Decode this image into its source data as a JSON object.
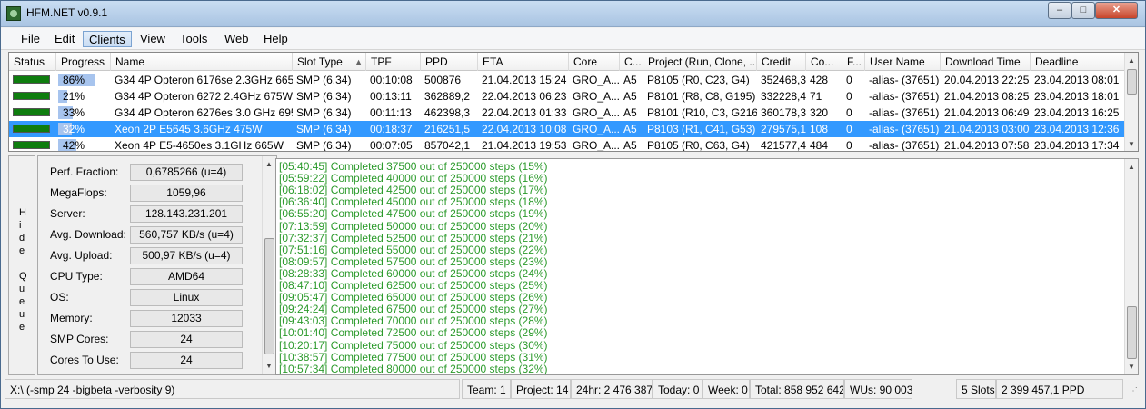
{
  "window": {
    "title": "HFM.NET v0.9.1",
    "min": "–",
    "max": "□",
    "close": "✕"
  },
  "menu": [
    "File",
    "Edit",
    "Clients",
    "View",
    "Tools",
    "Web",
    "Help"
  ],
  "grid": {
    "headers": [
      "Status",
      "Progress",
      "Name",
      "Slot Type",
      "TPF",
      "PPD",
      "ETA",
      "Core",
      "C...",
      "Project (Run, Clone, ...",
      "Credit",
      "Co...",
      "F...",
      "User Name",
      "Download Time",
      "Deadline"
    ],
    "sort_indicator": "▲",
    "rows": [
      {
        "progress": "86%",
        "pct": 86,
        "name": "G34 4P Opteron 6176se 2.3GHz 665 ...",
        "slot": "SMP (6.34)",
        "tpf": "00:10:08",
        "ppd": "500876",
        "eta": "21.04.2013 15:24",
        "core": "GRO_A...",
        "c": "A5",
        "project": "P8105 (R0, C23, G4)",
        "credit": "352468,3",
        "co": "428",
        "f": "0",
        "user": "-alias- (37651)",
        "download": "20.04.2013 22:25",
        "deadline": "23.04.2013 08:01"
      },
      {
        "progress": "21%",
        "pct": 21,
        "name": "G34 4P Opteron 6272 2.4GHz 675Watt",
        "slot": "SMP (6.34)",
        "tpf": "00:13:11",
        "ppd": "362889,2",
        "eta": "22.04.2013 06:23",
        "core": "GRO_A...",
        "c": "A5",
        "project": "P8101 (R8, C8, G195)",
        "credit": "332228,4",
        "co": "71",
        "f": "0",
        "user": "-alias- (37651)",
        "download": "21.04.2013 08:25",
        "deadline": "23.04.2013 18:01"
      },
      {
        "progress": "33%",
        "pct": 33,
        "name": "G34 4P Opteron 6276es 3.0 GHz 695...",
        "slot": "SMP (6.34)",
        "tpf": "00:11:13",
        "ppd": "462398,3",
        "eta": "22.04.2013 01:33",
        "core": "GRO_A...",
        "c": "A5",
        "project": "P8101 (R10, C3, G216)",
        "credit": "360178,3",
        "co": "320",
        "f": "0",
        "user": "-alias- (37651)",
        "download": "21.04.2013 06:49",
        "deadline": "23.04.2013 16:25"
      },
      {
        "progress": "32%",
        "pct": 32,
        "name": "Xeon 2P E5645 3.6GHz 475W",
        "slot": "SMP (6.34)",
        "tpf": "00:18:37",
        "ppd": "216251,5",
        "eta": "22.04.2013 10:08",
        "core": "GRO_A...",
        "c": "A5",
        "project": "P8103 (R1, C41, G53)",
        "credit": "279575,1",
        "co": "108",
        "f": "0",
        "user": "-alias- (37651)",
        "download": "21.04.2013 03:00",
        "deadline": "23.04.2013 12:36"
      },
      {
        "progress": "42%",
        "pct": 42,
        "name": "Xeon 4P E5-4650es 3.1GHz 665W",
        "slot": "SMP (6.34)",
        "tpf": "00:07:05",
        "ppd": "857042,1",
        "eta": "21.04.2013 19:53",
        "core": "GRO_A...",
        "c": "A5",
        "project": "P8105 (R0, C63, G4)",
        "credit": "421577,4",
        "co": "484",
        "f": "0",
        "user": "-alias- (37651)",
        "download": "21.04.2013 07:58",
        "deadline": "23.04.2013 17:34"
      }
    ]
  },
  "hide_queue": [
    "H",
    "i",
    "d",
    "e",
    "",
    "Q",
    "u",
    "e",
    "u",
    "e"
  ],
  "info": [
    {
      "label": "Perf. Fraction:",
      "value": "0,6785266 (u=4)"
    },
    {
      "label": "MegaFlops:",
      "value": "1059,96"
    },
    {
      "label": "Server:",
      "value": "128.143.231.201"
    },
    {
      "label": "Avg. Download:",
      "value": "560,757 KB/s (u=4)"
    },
    {
      "label": "Avg. Upload:",
      "value": "500,97 KB/s (u=4)"
    },
    {
      "label": "CPU Type:",
      "value": "AMD64"
    },
    {
      "label": "OS:",
      "value": "Linux"
    },
    {
      "label": "Memory:",
      "value": "12033"
    },
    {
      "label": "SMP Cores:",
      "value": "24"
    },
    {
      "label": "Cores To Use:",
      "value": "24"
    }
  ],
  "log": [
    "[05:40:45] Completed 37500 out of 250000 steps  (15%)",
    "[05:59:22] Completed 40000 out of 250000 steps  (16%)",
    "[06:18:02] Completed 42500 out of 250000 steps  (17%)",
    "[06:36:40] Completed 45000 out of 250000 steps  (18%)",
    "[06:55:20] Completed 47500 out of 250000 steps  (19%)",
    "[07:13:59] Completed 50000 out of 250000 steps  (20%)",
    "[07:32:37] Completed 52500 out of 250000 steps  (21%)",
    "[07:51:16] Completed 55000 out of 250000 steps  (22%)",
    "[08:09:57] Completed 57500 out of 250000 steps  (23%)",
    "[08:28:33] Completed 60000 out of 250000 steps  (24%)",
    "[08:47:10] Completed 62500 out of 250000 steps  (25%)",
    "[09:05:47] Completed 65000 out of 250000 steps  (26%)",
    "[09:24:24] Completed 67500 out of 250000 steps  (27%)",
    "[09:43:03] Completed 70000 out of 250000 steps  (28%)",
    "[10:01:40] Completed 72500 out of 250000 steps  (29%)",
    "[10:20:17] Completed 75000 out of 250000 steps  (30%)",
    "[10:38:57] Completed 77500 out of 250000 steps  (31%)",
    "[10:57:34] Completed 80000 out of 250000 steps  (32%)"
  ],
  "footer": {
    "path": "X:\\ (-smp 24 -bigbeta -verbosity 9)",
    "team": "Team: 1",
    "project": "Project: 14",
    "h24": "24hr: 2 476 387",
    "today": "Today: 0",
    "week": "Week: 0",
    "total": "Total: 858 952 642",
    "wus": "WUs: 90 003",
    "slots": "5 Slots",
    "ppd": "2 399 457,1 PPD"
  },
  "colors": {
    "selection": "#3399ff",
    "status_ok": "#0f7d0f",
    "log_text": "#2b9a2b",
    "progress": "#a7c4ee"
  }
}
